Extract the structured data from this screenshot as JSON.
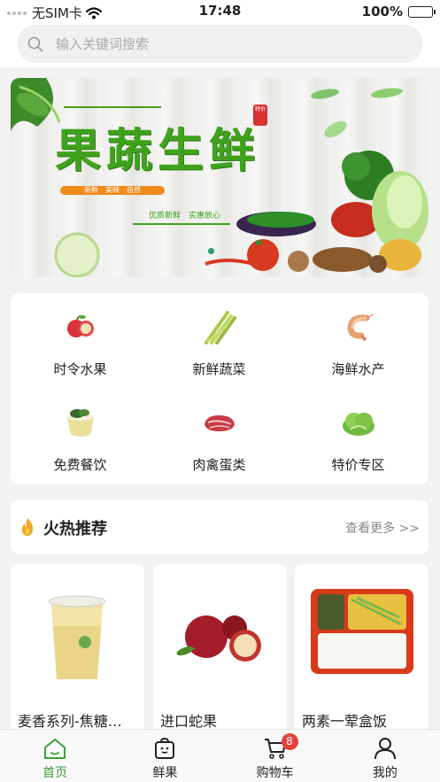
{
  "status_bar": {
    "carrier": "无SIM卡",
    "time": "17:48",
    "battery": "100%"
  },
  "search": {
    "placeholder": "输入关键词搜索"
  },
  "banner": {
    "title": "果蔬生鲜",
    "tag": "新鲜　美味　自然",
    "sub": "优质新鲜　实惠放心",
    "seal": "特价"
  },
  "categories": [
    {
      "label": "时令水果",
      "icon": "apple-icon"
    },
    {
      "label": "新鲜蔬菜",
      "icon": "asparagus-icon"
    },
    {
      "label": "海鲜水产",
      "icon": "shrimp-icon"
    },
    {
      "label": "免费餐饮",
      "icon": "meal-bowl-icon"
    },
    {
      "label": "肉禽蛋类",
      "icon": "meat-icon"
    },
    {
      "label": "特价专区",
      "icon": "lettuce-icon"
    }
  ],
  "hot": {
    "title": "火热推荐",
    "more": "查看更多 >>"
  },
  "products": [
    {
      "name": "麦香系列-焦糖…",
      "image": "milk-tea"
    },
    {
      "name": "进口蛇果",
      "image": "red-apples"
    },
    {
      "name": "两素一荤盒饭",
      "image": "lunch-box"
    }
  ],
  "tabbar": {
    "items": [
      {
        "label": "首页",
        "icon": "home-icon"
      },
      {
        "label": "鲜果",
        "icon": "bag-icon"
      },
      {
        "label": "购物车",
        "icon": "cart-icon"
      },
      {
        "label": "我的",
        "icon": "user-icon"
      }
    ],
    "active": 0,
    "cart_badge": "8"
  },
  "colors": {
    "accent": "#3aa13a",
    "badge": "#e8413a",
    "banner_green": "#3fa21d"
  }
}
